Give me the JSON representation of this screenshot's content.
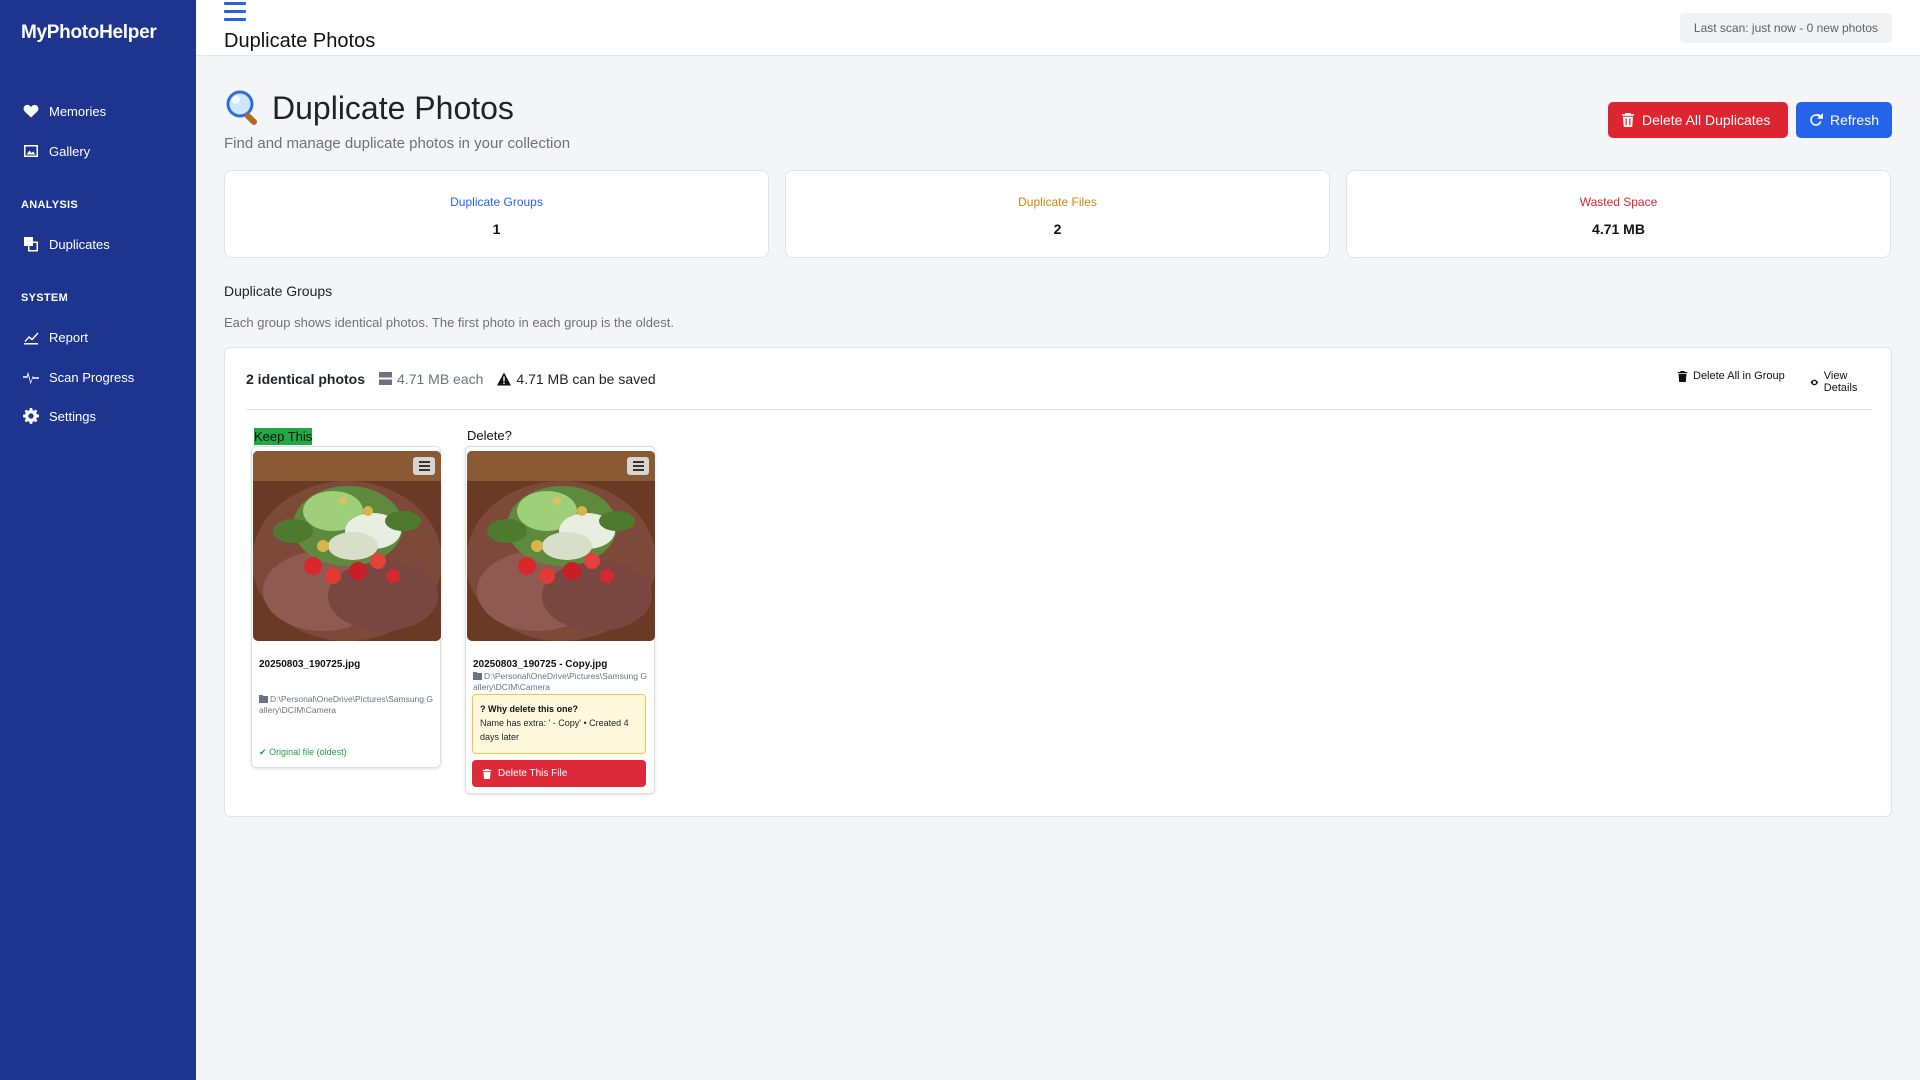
{
  "app": {
    "brand": "MyPhotoHelper"
  },
  "sidebar": {
    "items_top": [
      {
        "label": "Memories",
        "icon": "heart-icon"
      },
      {
        "label": "Gallery",
        "icon": "image-icon"
      }
    ],
    "section_analysis": "ANALYSIS",
    "items_analysis": [
      {
        "label": "Duplicates",
        "icon": "duplicates-icon"
      }
    ],
    "section_system": "SYSTEM",
    "items_system": [
      {
        "label": "Report",
        "icon": "chart-line-icon"
      },
      {
        "label": "Scan Progress",
        "icon": "pulse-icon"
      },
      {
        "label": "Settings",
        "icon": "gear-icon"
      }
    ]
  },
  "topbar": {
    "title": "Duplicate Photos",
    "scan_status": "Last scan: just now - 0 new photos"
  },
  "header": {
    "title": "Duplicate Photos",
    "subtitle": "Find and manage duplicate photos in your collection",
    "delete_all_label": "Delete All Duplicates",
    "refresh_label": "Refresh"
  },
  "stats": {
    "groups": {
      "label": "Duplicate Groups",
      "value": "1",
      "color": "#2563eb"
    },
    "files": {
      "label": "Duplicate Files",
      "value": "2",
      "color": "#c98a0a"
    },
    "wasted": {
      "label": "Wasted Space",
      "value": "4.71 MB",
      "color": "#dc2530"
    }
  },
  "groups_section": {
    "title": "Duplicate Groups",
    "description": "Each group shows identical photos. The first photo in each group is the oldest."
  },
  "group": {
    "count_label": "2 identical photos",
    "size_each": "4.71 MB each",
    "saved": "4.71 MB can be saved",
    "delete_all_in_group": "Delete All in Group",
    "view_details": "View Details",
    "keep_label": "Keep This",
    "delete_label": "Delete?",
    "photos": [
      {
        "filename": "20250803_190725.jpg",
        "path": "D:\\Personal\\OneDrive\\Pictures\\Samsung Gallery\\DCIM\\Camera",
        "note": "Original file (oldest)"
      },
      {
        "filename": "20250803_190725 - Copy.jpg",
        "path": "D:\\Personal\\OneDrive\\Pictures\\Samsung Gallery\\DCIM\\Camera",
        "why_title": "Why delete this one?",
        "why_text": "Name has extra: ' - Copy' • Created 4 days later",
        "delete_button": "Delete This File"
      }
    ]
  }
}
